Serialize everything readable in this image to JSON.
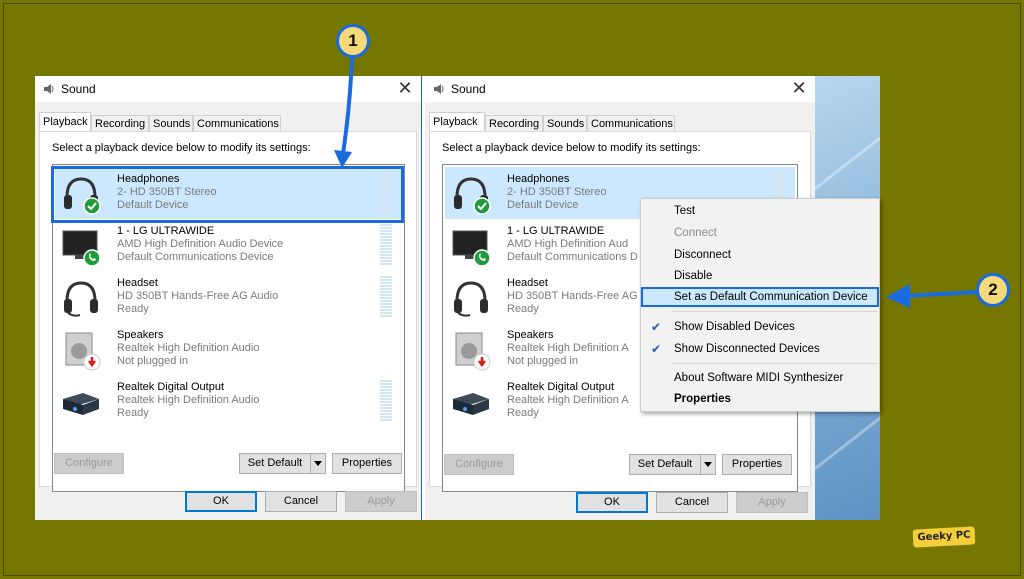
{
  "left_dialog": {
    "title": "Sound",
    "close_glyph": "✕",
    "tabs": [
      {
        "label": "Playback"
      },
      {
        "label": "Recording"
      },
      {
        "label": "Sounds"
      },
      {
        "label": "Communications"
      }
    ],
    "instruction": "Select a playback device below to modify its settings:",
    "devices": [
      {
        "name": "Headphones",
        "line2": "2- HD 350BT Stereo",
        "line3": "Default Device",
        "icon": "headphones-icon",
        "status": "check-badge-icon"
      },
      {
        "name": "1 - LG ULTRAWIDE",
        "line2": "AMD High Definition Audio Device",
        "line3": "Default Communications Device",
        "icon": "monitor-icon",
        "status": "phone-badge-icon"
      },
      {
        "name": "Headset",
        "line2": "HD 350BT Hands-Free AG Audio",
        "line3": "Ready",
        "icon": "headset-icon",
        "status": ""
      },
      {
        "name": "Speakers",
        "line2": "Realtek High Definition Audio",
        "line3": "Not plugged in",
        "icon": "speaker-icon",
        "status": "unplugged-badge-icon"
      },
      {
        "name": "Realtek Digital Output",
        "line2": "Realtek High Definition Audio",
        "line3": "Ready",
        "icon": "digital-output-icon",
        "status": ""
      }
    ],
    "buttons": {
      "configure": "Configure",
      "set_default": "Set Default",
      "properties": "Properties",
      "ok": "OK",
      "cancel": "Cancel",
      "apply": "Apply"
    }
  },
  "right_dialog": {
    "title": "Sound",
    "close_glyph": "✕",
    "tabs": [
      {
        "label": "Playback"
      },
      {
        "label": "Recording"
      },
      {
        "label": "Sounds"
      },
      {
        "label": "Communications"
      }
    ],
    "instruction": "Select a playback device below to modify its settings:",
    "devices": [
      {
        "name": "Headphones",
        "line2": "2- HD 350BT Stereo",
        "line3": "Default Device"
      },
      {
        "name": "1 - LG ULTRAWIDE",
        "line2": "AMD High Definition Aud",
        "line3": "Default Communications D"
      },
      {
        "name": "Headset",
        "line2": "HD 350BT Hands-Free AG",
        "line3": "Ready"
      },
      {
        "name": "Speakers",
        "line2": "Realtek High Definition A",
        "line3": "Not plugged in"
      },
      {
        "name": "Realtek Digital Output",
        "line2": "Realtek High Definition A",
        "line3": "Ready"
      }
    ],
    "buttons": {
      "configure": "Configure",
      "set_default": "Set Default",
      "properties": "Properties",
      "ok": "OK",
      "cancel": "Cancel",
      "apply": "Apply"
    }
  },
  "context_menu": {
    "items": [
      {
        "label": "Test",
        "state": "normal"
      },
      {
        "label": "Connect",
        "state": "disabled"
      },
      {
        "label": "Disconnect",
        "state": "normal"
      },
      {
        "label": "Disable",
        "state": "normal"
      },
      {
        "label": "Set as Default Communication Device",
        "state": "highlighted"
      },
      {
        "label": "Show Disabled Devices",
        "state": "checked"
      },
      {
        "label": "Show Disconnected Devices",
        "state": "checked"
      },
      {
        "label": "About Software MIDI Synthesizer",
        "state": "normal"
      },
      {
        "label": "Properties",
        "state": "bold"
      }
    ],
    "check_glyph": "✔"
  },
  "annotations": {
    "step1": "1",
    "step2": "2",
    "watermark": "Geeky PC"
  },
  "colors": {
    "background": "#767700",
    "highlight_border": "#1a6ae0",
    "selection": "#cce8ff",
    "badge_fill": "#f5d97b"
  }
}
